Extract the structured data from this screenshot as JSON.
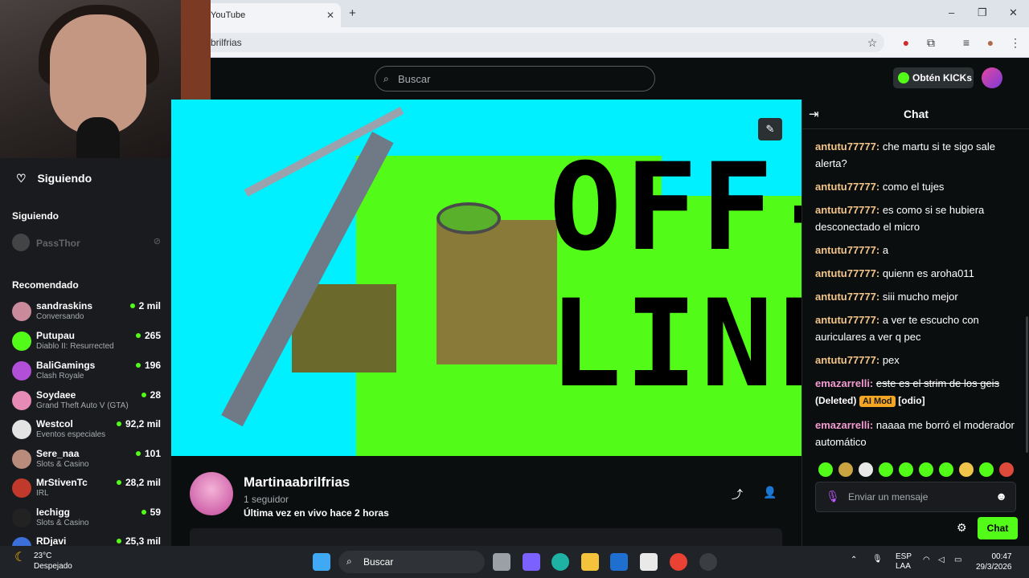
{
  "browser": {
    "tab_title": "YouTube",
    "url": "brilfrias"
  },
  "header": {
    "search_placeholder": "Buscar",
    "kicks_button": "Obtén KICKs"
  },
  "sidebar": {
    "following_button": "Siguiendo",
    "following_section": "Siguiendo",
    "offline_channel": "PassThor",
    "recommended_section": "Recomendado",
    "recommended": [
      {
        "name": "sandraskins",
        "game": "Conversando",
        "viewers": "2 mil",
        "color": "#c98a9c"
      },
      {
        "name": "Putupau",
        "game": "Diablo II: Resurrected",
        "viewers": "265",
        "color": "#53fc18"
      },
      {
        "name": "BaliGamings",
        "game": "Clash Royale",
        "viewers": "196",
        "color": "#b14fd9"
      },
      {
        "name": "Soydaee",
        "game": "Grand Theft Auto V (GTA)",
        "viewers": "28",
        "color": "#e78ab6"
      },
      {
        "name": "Westcol",
        "game": "Eventos especiales",
        "viewers": "92,2 mil",
        "color": "#e3e3e3"
      },
      {
        "name": "Sere_naa",
        "game": "Slots & Casino",
        "viewers": "101",
        "color": "#b98b7b"
      },
      {
        "name": "MrStivenTc",
        "game": "IRL",
        "viewers": "28,2 mil",
        "color": "#c0392b"
      },
      {
        "name": "lechigg",
        "game": "Slots & Casino",
        "viewers": "59",
        "color": "#222222"
      },
      {
        "name": "RDjavi",
        "game": "",
        "viewers": "25,3 mil",
        "color": "#3b6fd9"
      }
    ]
  },
  "banner": {
    "line1": "OFF-",
    "line2": "LINE"
  },
  "channel": {
    "name": "Martinaabrilfrias",
    "followers": "1 seguidor",
    "last_live": "Última vez en vivo hace 2 horas"
  },
  "chat": {
    "title": "Chat",
    "messages": [
      {
        "user": "antutu77777:",
        "text": "che martu si te sigo sale alerta?"
      },
      {
        "user": "antutu77777:",
        "text": "como el tujes"
      },
      {
        "user": "antutu77777:",
        "text": "es como si se hubiera desconectado el micro"
      },
      {
        "user": "antutu77777:",
        "text": "a"
      },
      {
        "user": "antutu77777:",
        "text": "quienn es aroha011"
      },
      {
        "user": "antutu77777:",
        "text": "siii mucho mejor"
      },
      {
        "user": "antutu77777:",
        "text": "a ver te escucho con auriculares a ver q pec"
      },
      {
        "user": "antutu77777:",
        "text": "pex"
      }
    ],
    "deleted_msg": {
      "user": "emazarrelli:",
      "text": "este es el strim de los geis",
      "deleted_label": "(Deleted)",
      "badge": "AI Mod",
      "tag": "[odio]"
    },
    "last_msg": {
      "user": "emazarrelli:",
      "text": "naaaa me borró el moderador automático"
    },
    "input_placeholder": "Enviar un mensaje",
    "send_button": "Chat"
  },
  "taskbar": {
    "temp": "23°C",
    "weather": "Despejado",
    "search": "Buscar",
    "lang1": "ESP",
    "lang2": "LAA",
    "time": "00:47",
    "date": "29/3/2026"
  }
}
